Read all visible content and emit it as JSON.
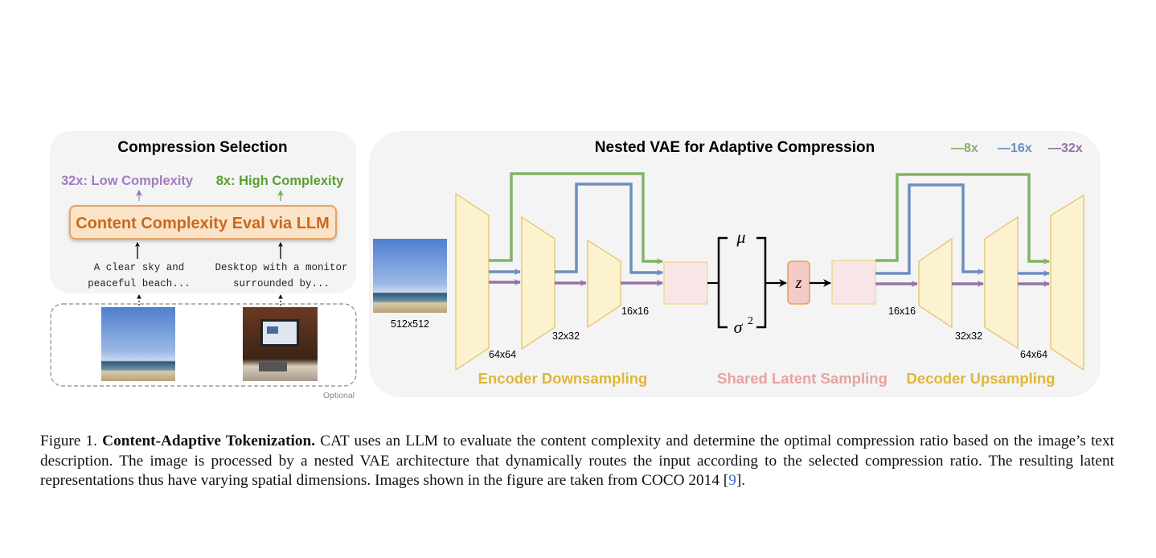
{
  "colors": {
    "green": "#82b366",
    "blue": "#6c8ebf",
    "purple": "#9673a6",
    "encoder": "#e0b63a",
    "latent": "#e8a3a0",
    "llm_text": "#c8691f"
  },
  "left_panel": {
    "title": "Compression Selection",
    "low_label": "32x: Low Complexity",
    "high_label": "8x: High Complexity",
    "llm_box": "Content Complexity Eval via LLM",
    "desc1_line1": "A clear sky and",
    "desc1_line2": "peaceful beach...",
    "desc2_line1": "Desktop with a monitor",
    "desc2_line2": "surrounded by...",
    "optional": "Optional"
  },
  "right_panel": {
    "title": "Nested VAE for Adaptive Compression",
    "legend": [
      "—8x",
      "—16x",
      "—32x"
    ],
    "input_size": "512x512",
    "enc_sizes": [
      "64x64",
      "32x32",
      "16x16"
    ],
    "dec_sizes": [
      "16x16",
      "32x32",
      "64x64"
    ],
    "mu": "μ",
    "sigma": "σ",
    "sigma_exp": "2",
    "z": "z",
    "encoder_label": "Encoder Downsampling",
    "latent_label": "Shared Latent Sampling",
    "decoder_label": "Decoder Upsampling"
  },
  "caption": {
    "prefix": "Figure 1. ",
    "bold": "Content-Adaptive Tokenization.",
    "body": " CAT uses an LLM to evaluate the content complexity and determine the optimal compression ratio based on the image’s text description. The image is processed by a nested VAE architecture that dynamically routes the input according to the selected compression ratio. The resulting latent representations thus have varying spatial dimensions. Images shown in the figure are taken from COCO 2014 [",
    "ref": "9",
    "suffix": "]."
  }
}
